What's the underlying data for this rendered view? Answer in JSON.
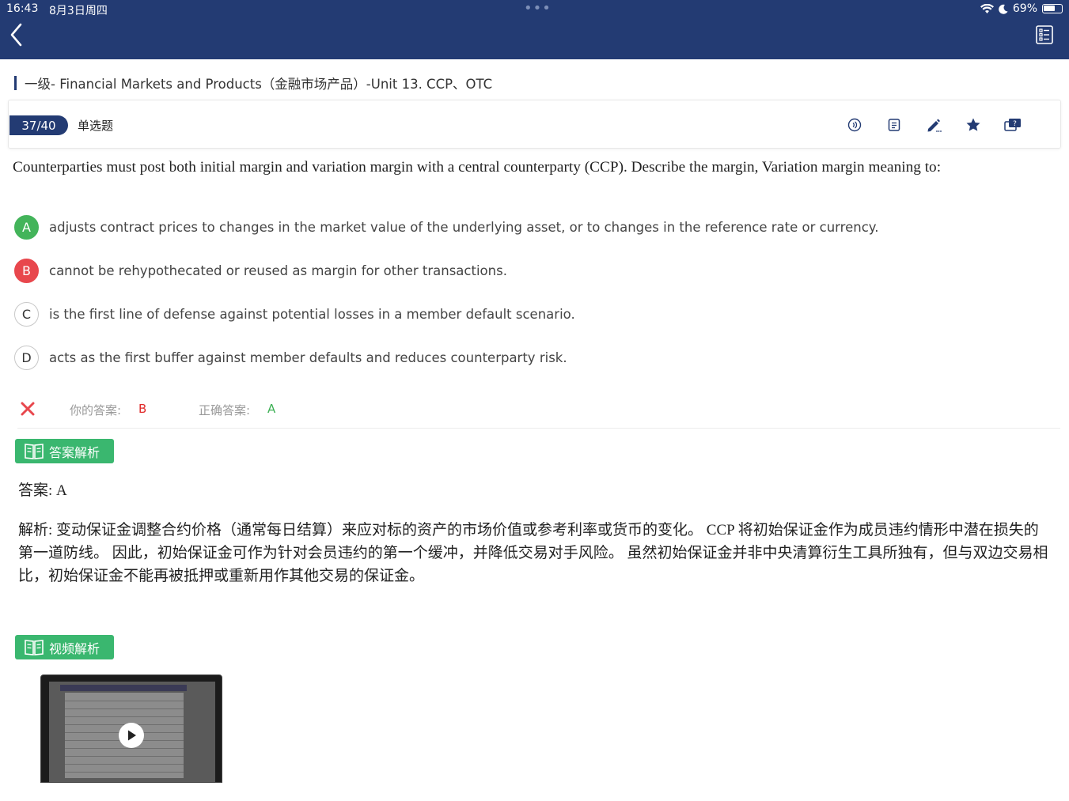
{
  "status": {
    "time": "16:43",
    "date": "8月3日周四",
    "battery": "69%",
    "battery_level": 0.69
  },
  "breadcrumb": "一级- Financial Markets and Products（金融市场产品）-Unit 13.   CCP、OTC",
  "question_header": {
    "progress": "37/40",
    "type": "单选题"
  },
  "question": "Counterparties must post both initial margin and variation margin with a central counterparty (CCP). Describe the margin, Variation margin meaning to:",
  "options": [
    {
      "letter": "A",
      "text": "adjusts contract prices to changes in the market value of the underlying asset, or to changes in the reference rate or currency.",
      "state": "correct"
    },
    {
      "letter": "B",
      "text": "cannot be rehypothecated or reused as margin for other transactions.",
      "state": "wrong"
    },
    {
      "letter": "C",
      "text": "is the first line of defense against potential losses in a member default scenario.",
      "state": "none"
    },
    {
      "letter": "D",
      "text": "acts as the first buffer against member defaults and reduces counterparty risk.",
      "state": "none"
    }
  ],
  "answer_row": {
    "your_label": "你的答案:",
    "your_value": "B",
    "correct_label": "正确答案:",
    "correct_value": "A"
  },
  "analysis": {
    "tag": "答案解析",
    "answer": "答案: A",
    "explanation": "解析: 变动保证金调整合约价格（通常每日结算）来应对标的资产的市场价值或参考利率或货币的变化。 CCP 将初始保证金作为成员违约情形中潜在损失的第一道防线。 因此，初始保证金可作为针对会员违约的第一个缓冲，并降低交易对手风险。 虽然初始保证金并非中央清算衍生工具所独有，但与双边交易相比，初始保证金不能再被抵押或重新用作其他交易的保证金。"
  },
  "video": {
    "tag": "视频解析"
  },
  "colors": {
    "header": "#233b73",
    "correct": "#43b45a",
    "wrong": "#e8474d",
    "tag": "#3ab76f"
  }
}
